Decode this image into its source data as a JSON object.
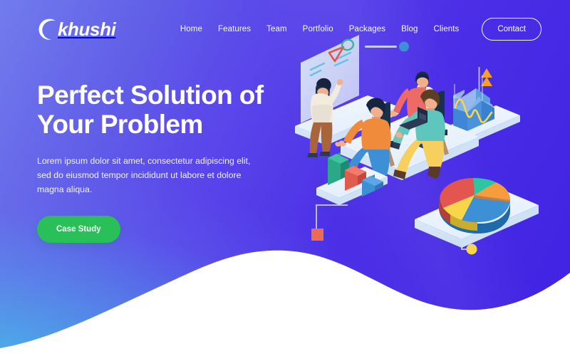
{
  "brand": {
    "name": "khushi",
    "logo_icon": "crescent-c-icon",
    "color": "#ffffff"
  },
  "nav": {
    "items": [
      {
        "label": "Home"
      },
      {
        "label": "Features"
      },
      {
        "label": "Team"
      },
      {
        "label": "Portfolio"
      },
      {
        "label": "Packages"
      },
      {
        "label": "Blog"
      },
      {
        "label": "Clients"
      }
    ],
    "contact_label": "Contact"
  },
  "hero": {
    "title_line1": "Perfect Solution of",
    "title_line2": "Your Problem",
    "subtitle": "Lorem ipsum dolor sit amet, consectetur adipiscing elit, sed do eiusmod tempor incididunt ut labore et dolore magna aliqua.",
    "cta_label": "Case Study",
    "cta_color": "#29c05a"
  },
  "theme": {
    "gradient_top_left": "#6272e8",
    "gradient_top_right": "#3b1fe0",
    "gradient_bottom_left": "#3fb8e0",
    "wave_color": "#ffffff",
    "text_color": "#ffffff"
  },
  "illustration": {
    "name": "isometric-business-analytics-scene",
    "platforms": [
      {
        "name": "whiteboard-platform"
      },
      {
        "name": "meeting-platform"
      },
      {
        "name": "bar-chart-platform"
      },
      {
        "name": "area-chart-platform"
      },
      {
        "name": "pie-chart-platform"
      }
    ],
    "whiteboard": {
      "shapes": [
        "red-triangle",
        "green-circle",
        "blue-text-lines"
      ],
      "presenter": "standing-presenter-pointing"
    },
    "people": [
      {
        "name": "seated-woman-orange-top",
        "top_color": "#f08b3c",
        "pants_color": "#3d8fd6"
      },
      {
        "name": "seated-man-red-top",
        "top_color": "#ed6a66",
        "pants_color": "#6fc4b8"
      },
      {
        "name": "seated-man-teal-top-laptop",
        "top_color": "#5ec6bd",
        "pants_color": "#f7cf5e"
      }
    ],
    "bar_chart": {
      "bars": [
        {
          "color": "#2aa888",
          "height": 1.0
        },
        {
          "color": "#e15b4e",
          "height": 0.7
        },
        {
          "color": "#3d8fd6",
          "height": 0.42
        }
      ]
    },
    "area_chart": {
      "layers": [
        "#74b3e8",
        "#3c86d8",
        "#2f6fc4"
      ],
      "line_color": "#f7d64a"
    },
    "pie_chart": {
      "slices": [
        {
          "label": "blue",
          "color": "#3d8fd6",
          "value": 28
        },
        {
          "label": "yellow",
          "color": "#f7d64a",
          "value": 22
        },
        {
          "label": "red",
          "color": "#e2564f",
          "value": 24
        },
        {
          "label": "teal",
          "color": "#2ec6a0",
          "value": 12
        },
        {
          "label": "orange",
          "color": "#f59c3c",
          "value": 14
        }
      ]
    },
    "decorations": [
      {
        "name": "blue-dot-marker",
        "color": "#3d8fd6"
      },
      {
        "name": "yellow-dot-marker",
        "color": "#f7d64a"
      },
      {
        "name": "orange-square-marker",
        "color": "#ee6b53"
      },
      {
        "name": "orange-triangle-marker",
        "color": "#f7a025"
      }
    ]
  }
}
